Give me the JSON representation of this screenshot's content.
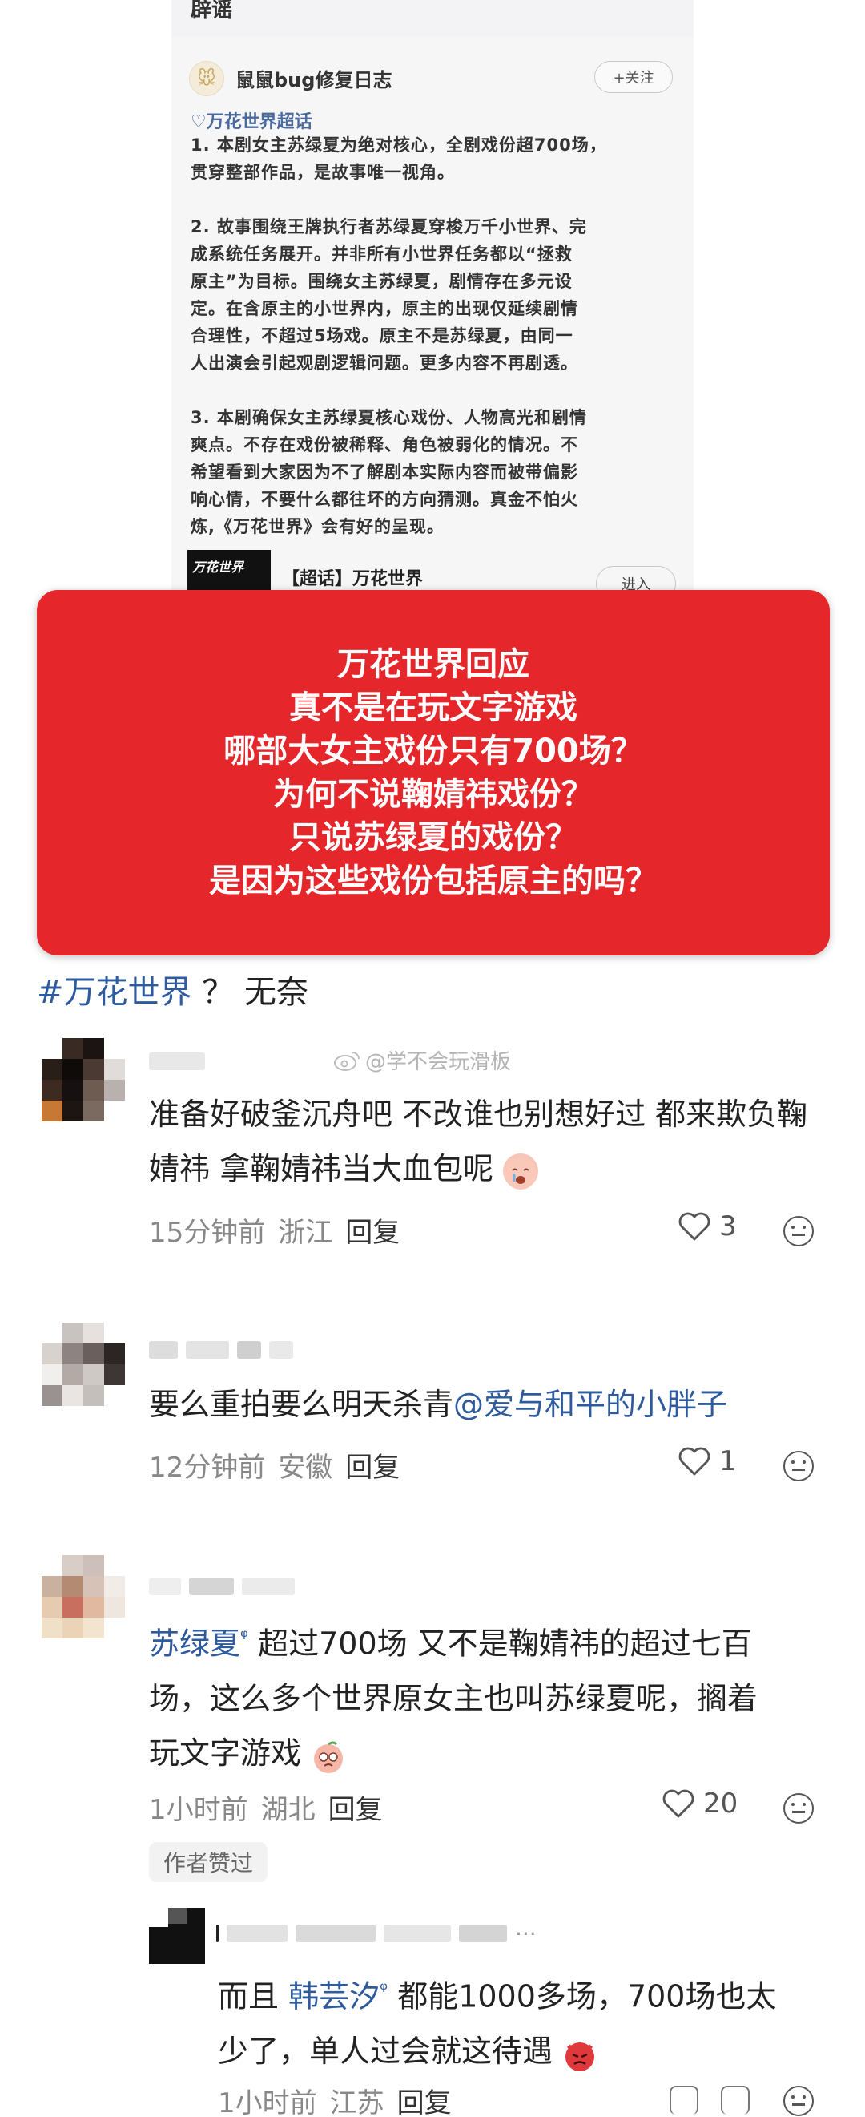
{
  "embedded_post": {
    "top_title": "辟谣",
    "author": "鼠鼠bug修复日志",
    "follow_label": "+关注",
    "tag": "♡万花世界超话",
    "body": "1. 本剧女主苏绿夏为绝对核心，全剧戏份超700场，\n贯穿整部作品，是故事唯一视角。\n\n2. 故事围绕王牌执行者苏绿夏穿梭万千小世界、完\n成系统任务展开。并非所有小世界任务都以“拯救\n原主”为目标。围绕女主苏绿夏，剧情存在多元设\n定。在含原主的小世界内，原主的出现仅延续剧情\n合理性，不超过5场戏。原主不是苏绿夏，由同一\n人出演会引起观剧逻辑问题。更多内容不再剧透。\n\n3. 本剧确保女主苏绿夏核心戏份、人物高光和剧情\n爽点。不存在戏份被稀释、角色被弱化的情况。不\n希望看到大家因为不了解剧本实际内容而被带偏影\n响心情，不要什么都往坏的方向猜测。真金不怕火\n炼,《万花世界》会有好的呈现。",
    "link_thumb_text": "万花世界",
    "link_title": "【超话】万花世界",
    "enter_label": "进入"
  },
  "banner": {
    "lines": [
      "万花世界回应",
      "真不是在玩文字游戏",
      "哪部大女主戏份只有700场？",
      "为何不说鞠婧祎戏份？",
      "只说苏绿夏的戏份？",
      "是因为这些戏份包括原主的吗？"
    ],
    "color": "#e5262b"
  },
  "post": {
    "hashtag": "#万花世界",
    "rest": "？ 无奈"
  },
  "watermark": "@学不会玩滑板",
  "comments": [
    {
      "text": "准备好破釜沉舟吧 不改谁也别想好过 都来欺负鞠婧祎 拿鞠婧祎当大血包呢",
      "time": "15分钟前",
      "location": "浙江",
      "reply_label": "回复",
      "likes": "3"
    },
    {
      "text_plain": "要么重拍要么明天杀青",
      "mention": "@爱与和平的小胖子",
      "time": "12分钟前",
      "location": "安徽",
      "reply_label": "回复",
      "likes": "1"
    },
    {
      "mention": "苏绿夏",
      "text_line1": "超过700场 又不是鞠婧祎的超过七百",
      "text_line2": "场，这么多个世界原女主也叫苏绿夏呢，搁着",
      "text_line3": "玩文字游戏",
      "time": "1小时前",
      "location": "湖北",
      "reply_label": "回复",
      "likes": "20",
      "author_liked": "作者赞过"
    }
  ],
  "sub_reply": {
    "prefix": "而且",
    "mention": "韩芸汐",
    "text_line1": "都能1000多场，700场也太",
    "text_line2": "少了，单人过会就这待遇",
    "time": "1小时前",
    "location": "江苏",
    "reply_label": "回复"
  }
}
